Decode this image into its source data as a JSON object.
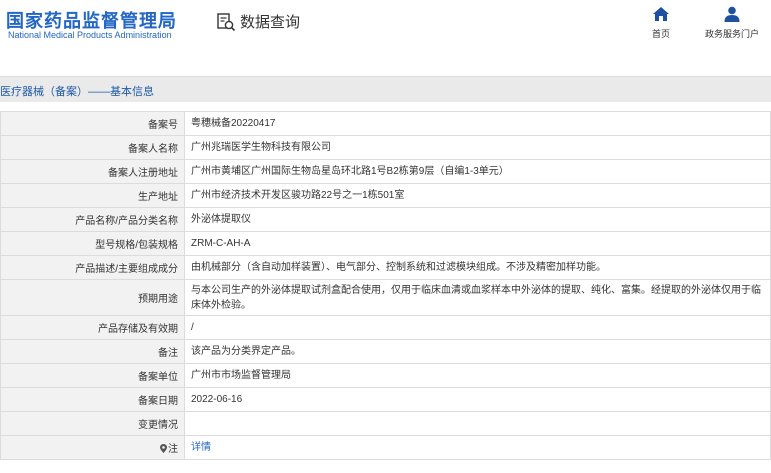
{
  "header": {
    "brand_cn": "国家药品监督管理局",
    "brand_en": "National Medical Products Administration",
    "query_label": "数据查询",
    "nav": [
      {
        "label": "首页",
        "icon": "home-icon"
      },
      {
        "label": "政务服务门户",
        "icon": "user-icon"
      }
    ]
  },
  "colors": {
    "brand": "#2266c6",
    "label_bg": "#f2f2f2",
    "section_bg": "#eaeaea"
  },
  "section": {
    "title": "医疗器械（备案）——基本信息"
  },
  "rows": [
    {
      "label": "备案号",
      "value": "粤穗械备20220417"
    },
    {
      "label": "备案人名称",
      "value": "广州兆瑞医学生物科技有限公司"
    },
    {
      "label": "备案人注册地址",
      "value": "广州市黄埔区广州国际生物岛星岛环北路1号B2栋第9层（自编1-3单元）"
    },
    {
      "label": "生产地址",
      "value": "广州市经济技术开发区骏功路22号之一1栋501室"
    },
    {
      "label": "产品名称/产品分类名称",
      "value": "外泌体提取仪"
    },
    {
      "label": "型号规格/包装规格",
      "value": "ZRM-C-AH-A"
    },
    {
      "label": "产品描述/主要组成成分",
      "value": "由机械部分（含自动加样装置）、电气部分、控制系统和过滤模块组成。不涉及精密加样功能。"
    },
    {
      "label": "预期用途",
      "value": "与本公司生产的外泌体提取试剂盒配合使用，仅用于临床血清或血浆样本中外泌体的提取、纯化、富集。经提取的外泌体仅用于临床体外检验。"
    },
    {
      "label": "产品存储及有效期",
      "value": "/"
    },
    {
      "label": "备注",
      "value": "该产品为分类界定产品。"
    },
    {
      "label": "备案单位",
      "value": "广州市市场监督管理局"
    },
    {
      "label": "备案日期",
      "value": "2022-06-16"
    },
    {
      "label": "变更情况",
      "value": ""
    },
    {
      "label": "注",
      "value": "详情"
    }
  ]
}
